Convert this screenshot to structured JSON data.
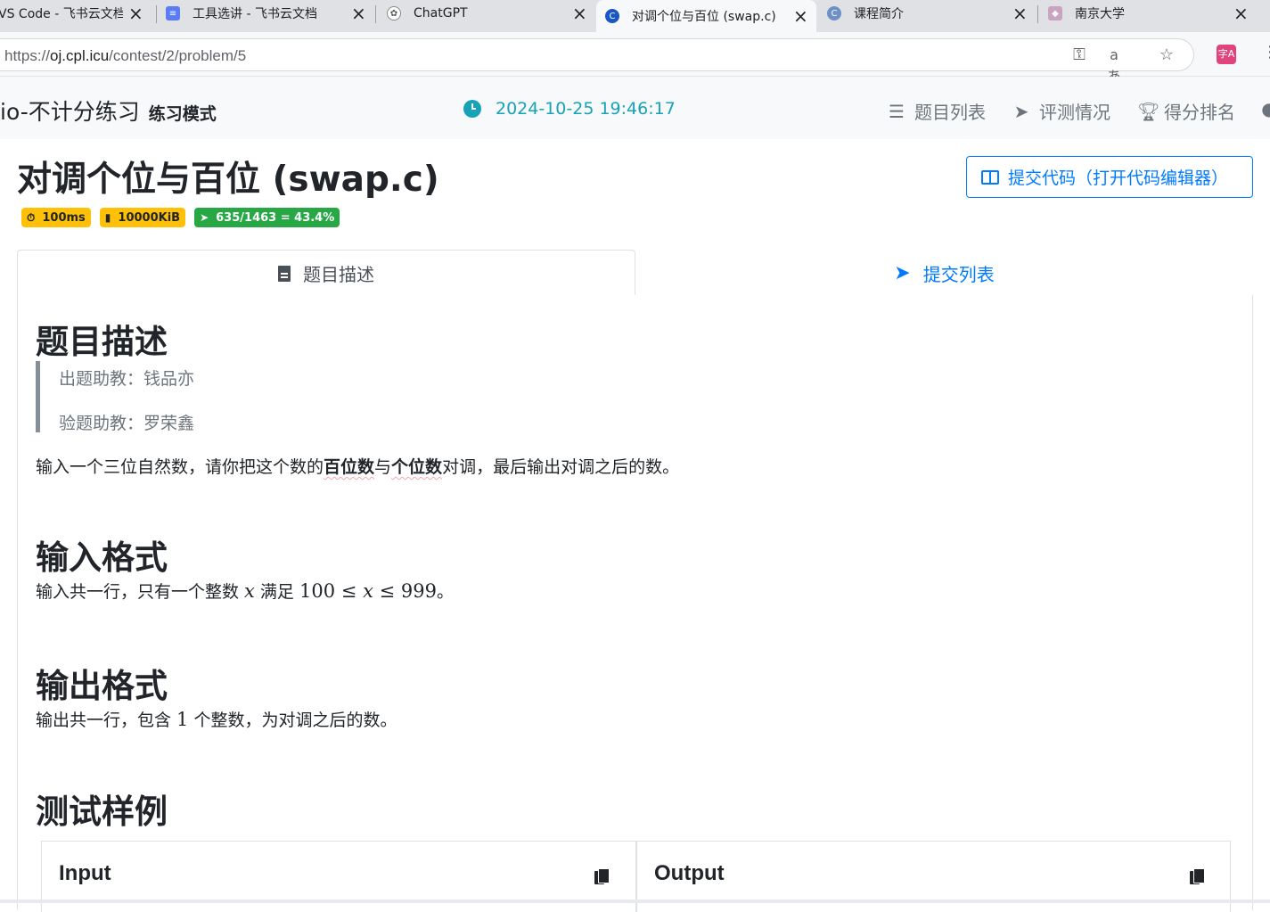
{
  "browser": {
    "tabs": [
      {
        "title": "VS Code - 飞书云文档",
        "favicon": "feishu-icon",
        "active": false
      },
      {
        "title": "工具选讲 - 飞书云文档",
        "favicon": "feishu-doc-icon",
        "active": false
      },
      {
        "title": "ChatGPT",
        "favicon": "chatgpt-icon",
        "active": false
      },
      {
        "title": "对调个位与百位 (swap.c)",
        "favicon": "oj-icon",
        "active": true
      },
      {
        "title": "课程简介",
        "favicon": "course-icon",
        "active": false
      },
      {
        "title": "南京大学",
        "favicon": "nju-icon",
        "active": false
      }
    ],
    "url_scheme": "https://",
    "url_host": "oj.cpl.icu",
    "url_path": "/contest/2/problem/5",
    "extension_label": "字A"
  },
  "navbar": {
    "brand": "io-不计分练习",
    "mode": "练习模式",
    "time": "2024-10-25 19:46:17",
    "links": [
      {
        "label": "题目列表",
        "icon": "list-icon"
      },
      {
        "label": "评测情况",
        "icon": "paper-plane-icon"
      },
      {
        "label": "得分排名",
        "icon": "trophy-icon"
      }
    ]
  },
  "problem": {
    "title": "对调个位与百位 (swap.c)",
    "open_editor_label": "提交代码（打开代码编辑器）",
    "time_limit": "100ms",
    "memory_limit": "10000KiB",
    "acceptance": "635/1463 = 43.4%",
    "colors": {
      "warning": "#ffc107",
      "success": "#28a745",
      "primary": "#007bff",
      "info": "#17a2b8"
    }
  },
  "tabs": {
    "description": "题目描述",
    "submissions": "提交列表"
  },
  "content": {
    "desc_heading": "题目描述",
    "setter": "出题助教：钱品亦",
    "tester": "验题助教：罗荣鑫",
    "desc_pre": "输入一个三位自然数，请你把这个数的",
    "desc_b1": "百位数",
    "desc_mid": "与",
    "desc_b2": "个位数",
    "desc_post": "对调，最后输出对调之后的数。",
    "input_heading": "输入格式",
    "input_pre": "输入共一行，只有一个整数 ",
    "input_var": "x",
    "input_mid": " 满足 ",
    "input_low": "100",
    "input_le1": "≤",
    "input_var2": "x",
    "input_le2": "≤",
    "input_high": "999",
    "input_end": "。",
    "output_heading": "输出格式",
    "output_pre": "输出共一行，包含 ",
    "output_num": "1",
    "output_post": " 个整数，为对调之后的数。",
    "sample_heading": "测试样例",
    "sample_input_label": "Input",
    "sample_output_label": "Output"
  }
}
